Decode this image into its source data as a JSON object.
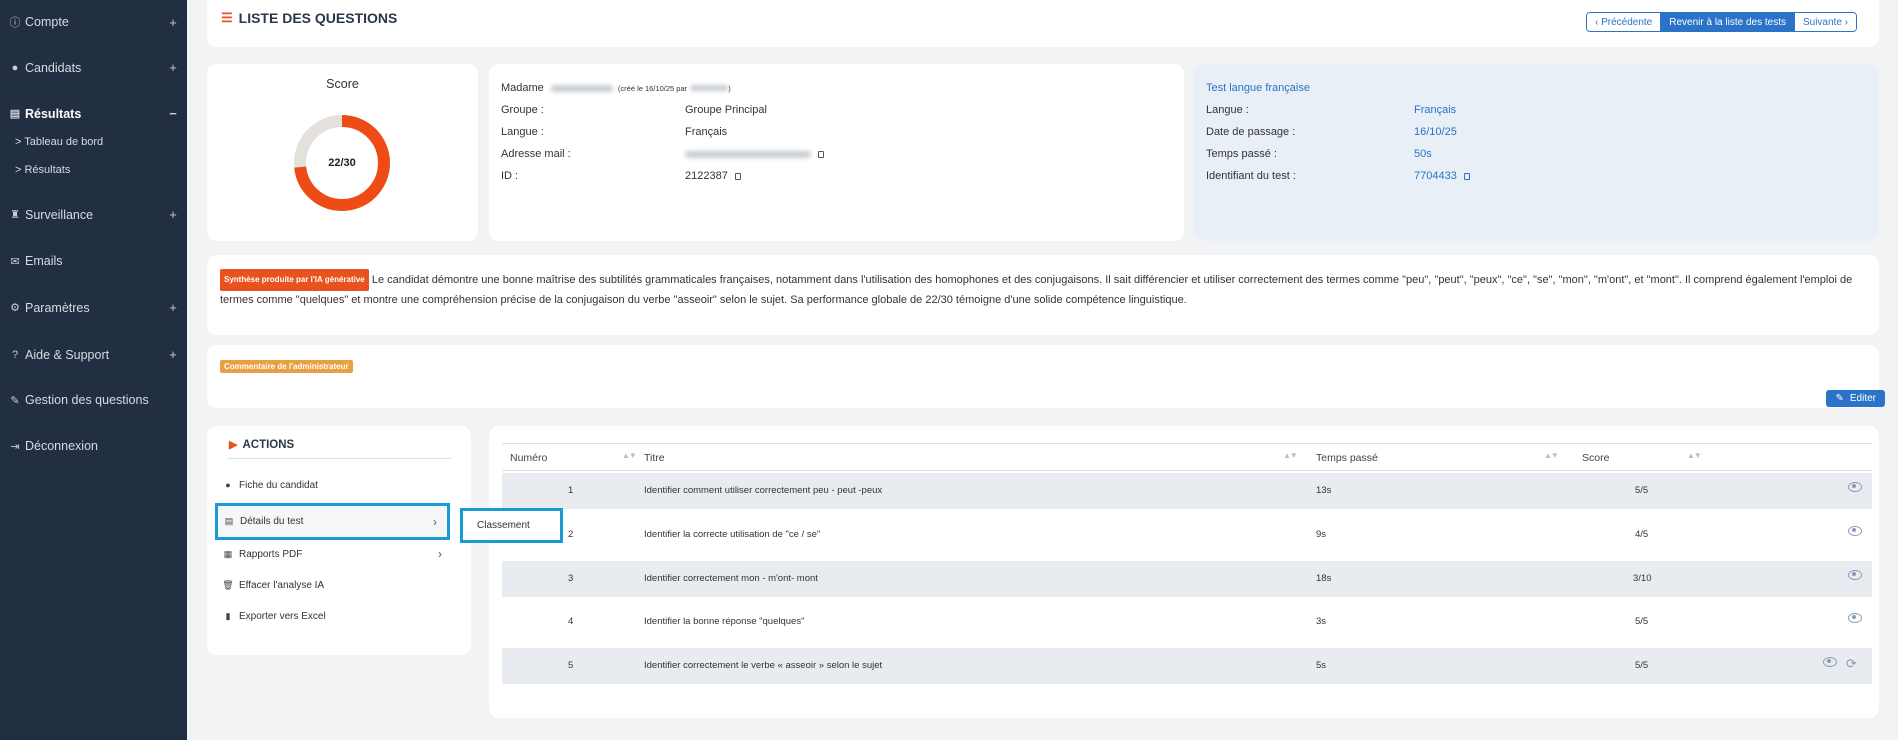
{
  "sidebar": {
    "items": [
      {
        "label": "Compte",
        "icon": "info-circle-icon",
        "toggle": "+"
      },
      {
        "label": "Candidats",
        "icon": "user-icon",
        "toggle": "+"
      },
      {
        "label": "Résultats",
        "icon": "chart-bar-icon",
        "toggle": "−"
      },
      {
        "label": "Surveillance",
        "icon": "binoculars-icon",
        "toggle": "+"
      },
      {
        "label": "Emails",
        "icon": "envelope-icon",
        "toggle": ""
      },
      {
        "label": "Paramètres",
        "icon": "gear-icon",
        "toggle": "+"
      },
      {
        "label": "Aide & Support",
        "icon": "question-circle-icon",
        "toggle": "+"
      },
      {
        "label": "Gestion des questions",
        "icon": "edit-icon",
        "toggle": ""
      },
      {
        "label": "Déconnexion",
        "icon": "sign-out-icon",
        "toggle": ""
      }
    ],
    "subitems": [
      "> Tableau de bord",
      "> Résultats"
    ]
  },
  "header": {
    "title": "LISTE DES QUESTIONS",
    "nav": {
      "prev": "Précédente",
      "back": "Revenir à la liste des tests",
      "next": "Suivante"
    }
  },
  "score": {
    "label": "Score",
    "text": "22/30",
    "value": 22,
    "max": 30,
    "color": "#ee4b16"
  },
  "candidate": {
    "salutation": "Madame",
    "created": "(créé le 16/10/25 par",
    "fields": [
      {
        "label": "Groupe :",
        "value": "Groupe Principal"
      },
      {
        "label": "Langue :",
        "value": "Français"
      },
      {
        "label": "Adresse mail :",
        "value": ""
      },
      {
        "label": "ID :",
        "value": "2122387"
      }
    ]
  },
  "test": {
    "title": "Test langue française",
    "fields": [
      {
        "label": "Langue :",
        "value": "Français"
      },
      {
        "label": "Date de passage :",
        "value": "16/10/25"
      },
      {
        "label": "Temps passé :",
        "value": "50s"
      },
      {
        "label": "Identifiant du test :",
        "value": "7704433"
      }
    ]
  },
  "synthesis": {
    "badge": "Synthèse produite par l'IA générative",
    "text": "Le candidat démontre une bonne maîtrise des subtilités grammaticales françaises, notamment dans l'utilisation des homophones et des conjugaisons. Il sait différencier et utiliser correctement des termes comme \"peu\", \"peut\", \"peux\", \"ce\", \"se\", \"mon\", \"m'ont\", et \"mont\". Il comprend également l'emploi de termes comme \"quelques\" et montre une compréhension précise de la conjugaison du verbe \"asseoir\" selon le sujet. Sa performance globale de 22/30 témoigne d'une solide compétence linguistique."
  },
  "admin": {
    "badge": "Commentaire de l'administrateur",
    "edit": "Editer"
  },
  "actions": {
    "title": "ACTIONS",
    "items": [
      {
        "label": "Fiche du candidat"
      },
      {
        "label": "Détails du test"
      },
      {
        "label": "Rapports PDF"
      },
      {
        "label": "Effacer l'analyse IA"
      },
      {
        "label": "Exporter vers Excel"
      }
    ],
    "flyout": "Classement"
  },
  "table": {
    "headers": [
      "Numéro",
      "Titre",
      "Temps passé",
      "Score"
    ],
    "rows": [
      {
        "num": "1",
        "title": "Identifier comment utiliser correctement peu - peut -peux",
        "time": "13s",
        "score": "5/5"
      },
      {
        "num": "2",
        "title": "Identifier la correcte utilisation de \"ce / se\"",
        "time": "9s",
        "score": "4/5"
      },
      {
        "num": "3",
        "title": "Identifier correctement mon - m'ont- mont",
        "time": "18s",
        "score": "3/10"
      },
      {
        "num": "4",
        "title": "Identifier la bonne réponse \"quelques\"",
        "time": "3s",
        "score": "5/5"
      },
      {
        "num": "5",
        "title": "Identifier correctement le verbe « asseoir » selon le sujet",
        "time": "5s",
        "score": "5/5"
      }
    ]
  },
  "colors": {
    "accent": "#2a73c8",
    "orange": "#e8521c",
    "sidebar": "#222e42",
    "highlight": "#1a9bd7",
    "adminBadge": "#e8a042"
  }
}
